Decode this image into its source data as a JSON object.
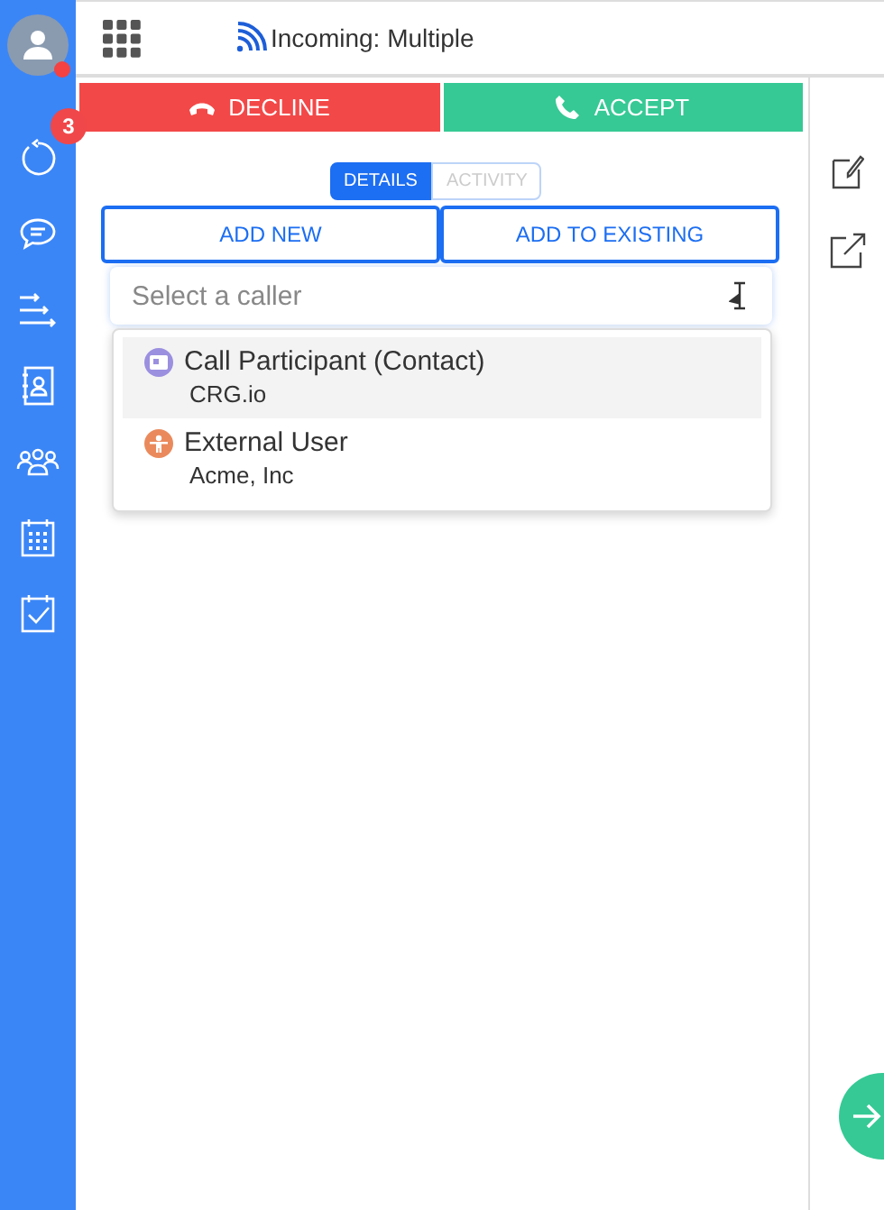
{
  "header": {
    "title": "Incoming: Multiple"
  },
  "sidebar": {
    "badge": "3",
    "items": [
      {
        "kind": "history"
      },
      {
        "kind": "chat"
      },
      {
        "kind": "transfer"
      },
      {
        "kind": "contact"
      },
      {
        "kind": "group"
      },
      {
        "kind": "calendar"
      },
      {
        "kind": "task"
      }
    ]
  },
  "call_actions": [
    {
      "label": "DECLINE",
      "kind": "decline"
    },
    {
      "label": "ACCEPT",
      "kind": "accept"
    }
  ],
  "tabs": [
    {
      "label": "DETAILS",
      "selected": true
    },
    {
      "label": "ACTIVITY",
      "selected": false
    }
  ],
  "add_buttons": [
    "ADD NEW",
    "ADD TO EXISTING"
  ],
  "search": {
    "placeholder": "Select a caller"
  },
  "dropdown": [
    {
      "kind": "contact",
      "name": "Call Participant (Contact)",
      "detail": "CRG.io",
      "selected": true
    },
    {
      "kind": "external",
      "name": "External User",
      "detail": "Acme, Inc",
      "selected": false
    }
  ]
}
